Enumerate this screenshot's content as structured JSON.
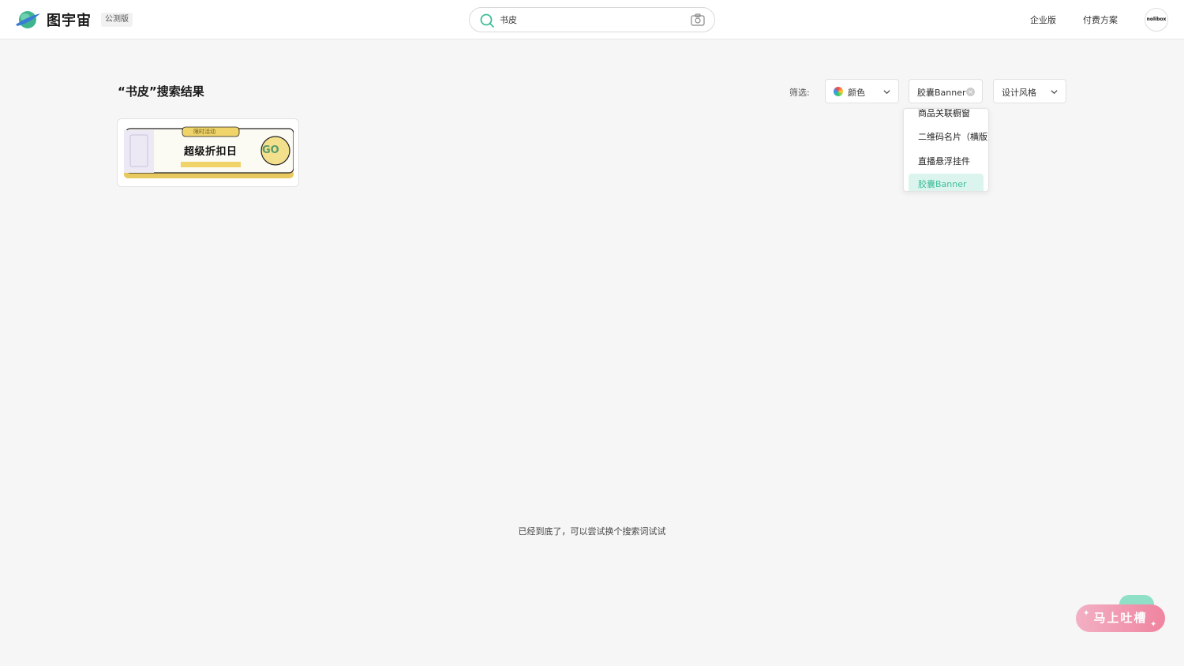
{
  "header": {
    "brand": "图宇宙",
    "beta_badge": "公测版",
    "search": {
      "value": "书皮"
    },
    "nav": [
      "企业版",
      "付费方案"
    ],
    "avatar_text": "nolibox"
  },
  "main": {
    "title": "“书皮”搜索结果",
    "filters": {
      "label": "筛选:",
      "color_label": "颜色",
      "type_label": "胶囊Banner",
      "style_label": "设计风格"
    },
    "dropdown": {
      "items": [
        "商品关联橱窗",
        "二维码名片（横版）",
        "直播悬浮挂件",
        "胶囊Banner"
      ],
      "selected": "胶囊Banner"
    },
    "results": [
      {
        "tag": "限时活动",
        "headline": "超级折扣日",
        "cta": "GO"
      }
    ],
    "end_note": "已经到底了，可以尝试换个搜索词试试"
  },
  "feedback": {
    "label": "马上吐槽"
  },
  "colors": {
    "accent": "#3fbd99",
    "feedback_pink": "#f0849f"
  }
}
